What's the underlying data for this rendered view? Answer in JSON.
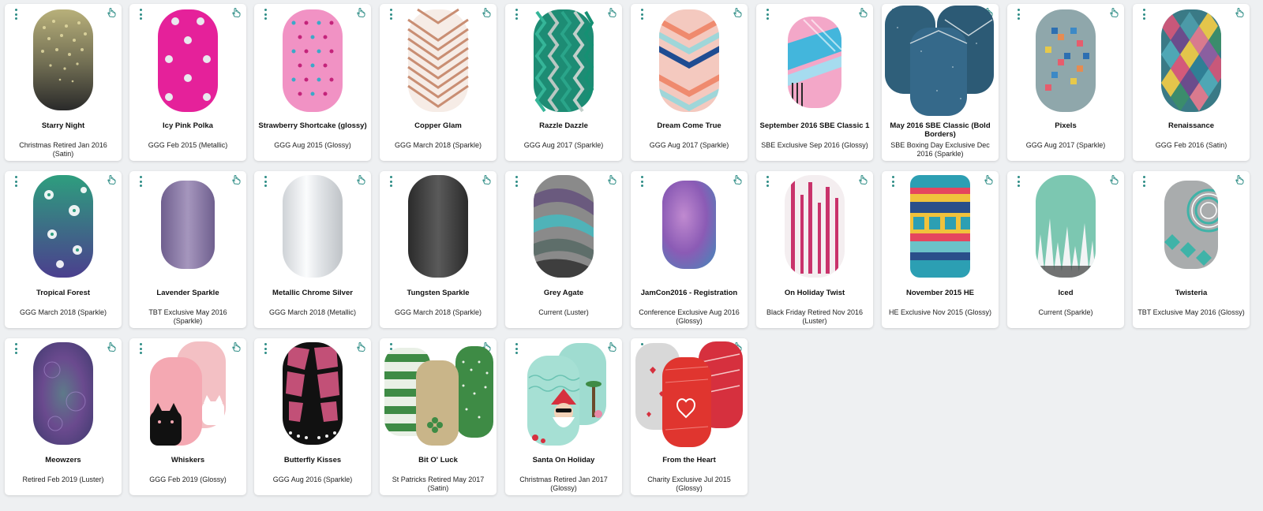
{
  "cards": [
    {
      "name": "Starry Night",
      "sub": "Christmas Retired Jan 2016 (Satin)"
    },
    {
      "name": "Icy Pink Polka",
      "sub": "GGG Feb 2015 (Metallic)"
    },
    {
      "name": "Strawberry Shortcake (glossy)",
      "sub": "GGG Aug 2015 (Glossy)"
    },
    {
      "name": "Copper Glam",
      "sub": "GGG March 2018 (Sparkle)"
    },
    {
      "name": "Razzle Dazzle",
      "sub": "GGG Aug 2017 (Sparkle)"
    },
    {
      "name": "Dream Come True",
      "sub": "GGG Aug 2017 (Sparkle)"
    },
    {
      "name": "September 2016 SBE Classic 1",
      "sub": "SBE Exclusive Sep 2016 (Glossy)"
    },
    {
      "name": "May 2016 SBE Classic (Bold Borders)",
      "sub": "SBE Boxing Day Exclusive Dec 2016 (Sparkle)"
    },
    {
      "name": "Pixels",
      "sub": "GGG Aug 2017 (Sparkle)"
    },
    {
      "name": "Renaissance",
      "sub": "GGG Feb 2016 (Satin)"
    },
    {
      "name": "Tropical Forest",
      "sub": "GGG March 2018 (Sparkle)"
    },
    {
      "name": "Lavender Sparkle",
      "sub": "TBT Exclusive May 2016 (Sparkle)"
    },
    {
      "name": "Metallic Chrome Silver",
      "sub": "GGG March 2018 (Metallic)"
    },
    {
      "name": "Tungsten Sparkle",
      "sub": "GGG March 2018 (Sparkle)"
    },
    {
      "name": "Grey Agate",
      "sub": "Current (Luster)"
    },
    {
      "name": "JamCon2016 - Registration",
      "sub": "Conference Exclusive Aug 2016 (Glossy)"
    },
    {
      "name": "On Holiday Twist",
      "sub": "Black Friday Retired Nov 2016 (Luster)"
    },
    {
      "name": "November 2015 HE",
      "sub": "HE Exclusive Nov 2015 (Glossy)"
    },
    {
      "name": "Iced",
      "sub": "Current (Sparkle)"
    },
    {
      "name": "Twisteria",
      "sub": "TBT Exclusive May 2016 (Glossy)"
    },
    {
      "name": "Meowzers",
      "sub": "Retired Feb 2019 (Luster)"
    },
    {
      "name": "Whiskers",
      "sub": "GGG Feb 2019 (Glossy)"
    },
    {
      "name": "Butterfly Kisses",
      "sub": "GGG Aug 2016 (Sparkle)"
    },
    {
      "name": "Bit O' Luck",
      "sub": "St Patricks Retired May 2017 (Satin)"
    },
    {
      "name": "Santa On Holiday",
      "sub": "Christmas Retired Jan 2017 (Glossy)"
    },
    {
      "name": "From the Heart",
      "sub": "Charity Exclusive Jul 2015 (Glossy)"
    }
  ],
  "colors": {
    "accent": "#2e8d86",
    "page_bg": "#eef0f2",
    "card_bg": "#ffffff"
  },
  "icons": {
    "menu": "vertical-dots-icon",
    "hand": "hand-pointer-icon"
  }
}
